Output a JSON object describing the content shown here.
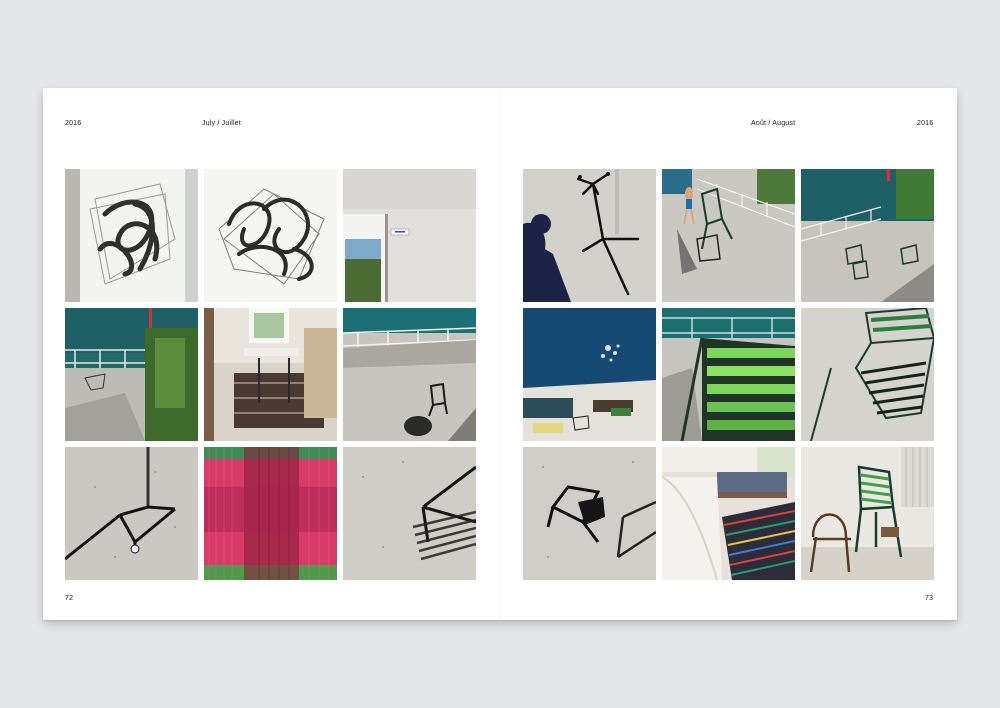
{
  "left_page": {
    "year": "2016",
    "month": "July / Juillet",
    "page_number": "72",
    "photos": [
      {
        "subject": "abstract-drawing-1-photo"
      },
      {
        "subject": "abstract-drawing-2-photo"
      },
      {
        "subject": "window-wall-photo"
      },
      {
        "subject": "terrace-railing-sea-photo"
      },
      {
        "subject": "interior-table-rug-photo"
      },
      {
        "subject": "terrace-chair-shadow-photo"
      },
      {
        "subject": "tripod-shadow-photo"
      },
      {
        "subject": "pink-woven-textile-photo"
      },
      {
        "subject": "chair-frame-shadow-photo"
      }
    ]
  },
  "right_page": {
    "month": "Août / August",
    "year": "2016",
    "page_number": "73",
    "photos": [
      {
        "subject": "coat-rack-shadow-photo"
      },
      {
        "subject": "swimmer-terrace-photo"
      },
      {
        "subject": "lake-terrace-chairs-photo"
      },
      {
        "subject": "blue-water-photo"
      },
      {
        "subject": "green-striped-chair-photo"
      },
      {
        "subject": "green-chair-shadow-photo"
      },
      {
        "subject": "black-chair-shadow-photo"
      },
      {
        "subject": "striped-rug-bedroom-photo"
      },
      {
        "subject": "green-chair-interior-photo"
      }
    ]
  },
  "colors": {
    "background": "#e6e7e8",
    "paper": "#ffffff",
    "text": "#222222",
    "lake_teal": "#1f5f66",
    "chair_green": "#1d5a3a",
    "textile_pink": "#d83a6a"
  }
}
